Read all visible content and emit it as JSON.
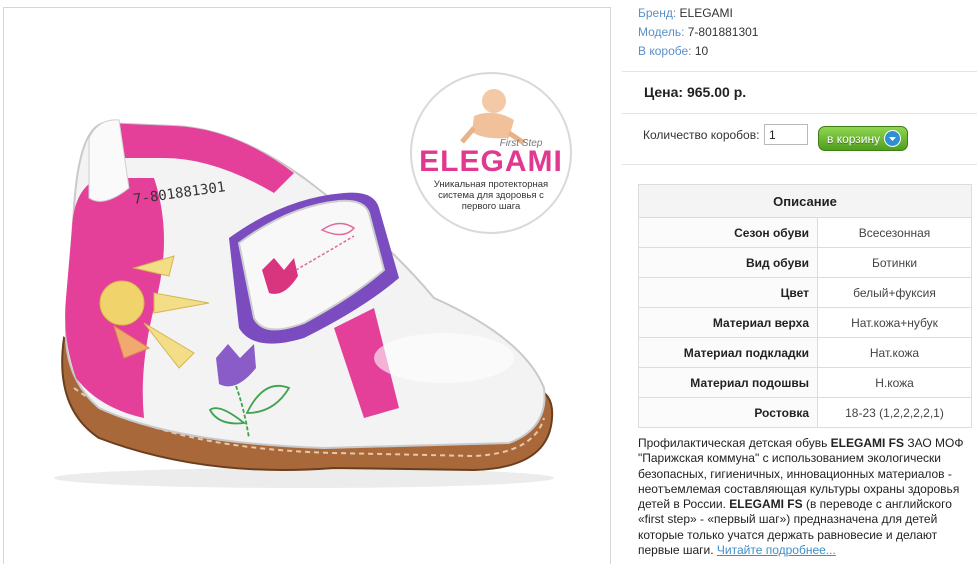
{
  "product": {
    "badge": {
      "brand_logo_text": "ELEGAMI",
      "tagline": "First Step",
      "caption_line1": "Уникальная протекторная",
      "caption_line2": "система для здоровья с",
      "caption_line3": "первого шага"
    }
  },
  "meta": {
    "brand_label": "Бренд:",
    "brand_value": "ELEGAMI",
    "model_label": "Модель:",
    "model_value": "7-801881301",
    "box_label": "В коробе:",
    "box_value": "10"
  },
  "price": "Цена: 965.00 р.",
  "order": {
    "qty_label": "Количество коробов:",
    "qty_value": "1",
    "cart_label": "в корзину"
  },
  "specs": {
    "header": "Описание",
    "rows": [
      {
        "key": "Сезон обуви",
        "value": "Всесезонная"
      },
      {
        "key": "Вид обуви",
        "value": "Ботинки"
      },
      {
        "key": "Цвет",
        "value": "белый+фуксия"
      },
      {
        "key": "Материал верха",
        "value": "Нат.кожа+нубук"
      },
      {
        "key": "Материал подкладки",
        "value": "Нат.кожа"
      },
      {
        "key": "Материал подошвы",
        "value": "Н.кожа"
      },
      {
        "key": "Ростовка",
        "value": "18-23 (1,2,2,2,2,1)"
      }
    ]
  },
  "description": {
    "p1": "Профилактическая детская обувь ",
    "b1": "ELEGAMI FS",
    "p2": " ЗАО МОФ \"Парижская коммуна\" с использованием экологически безопасных, гигиеничных, инновационных материалов - неотъемлемая составляющая культуры охраны здоровья детей в России. ",
    "b2": "ELEGAMI FS",
    "p3": " (в переводе с английского «first step» - «первый шаг») предназначена для детей которые только учатся держать равновесие и делают первые шаги. ",
    "read_more": "Читайте подробнее..."
  },
  "colors": {
    "label_blue": "#5b8fc7",
    "link_blue": "#3d8fc8",
    "cart_green": "#5aa924",
    "fuchsia": "#e0398f"
  },
  "icons": {
    "cart": "cart-download-icon"
  }
}
